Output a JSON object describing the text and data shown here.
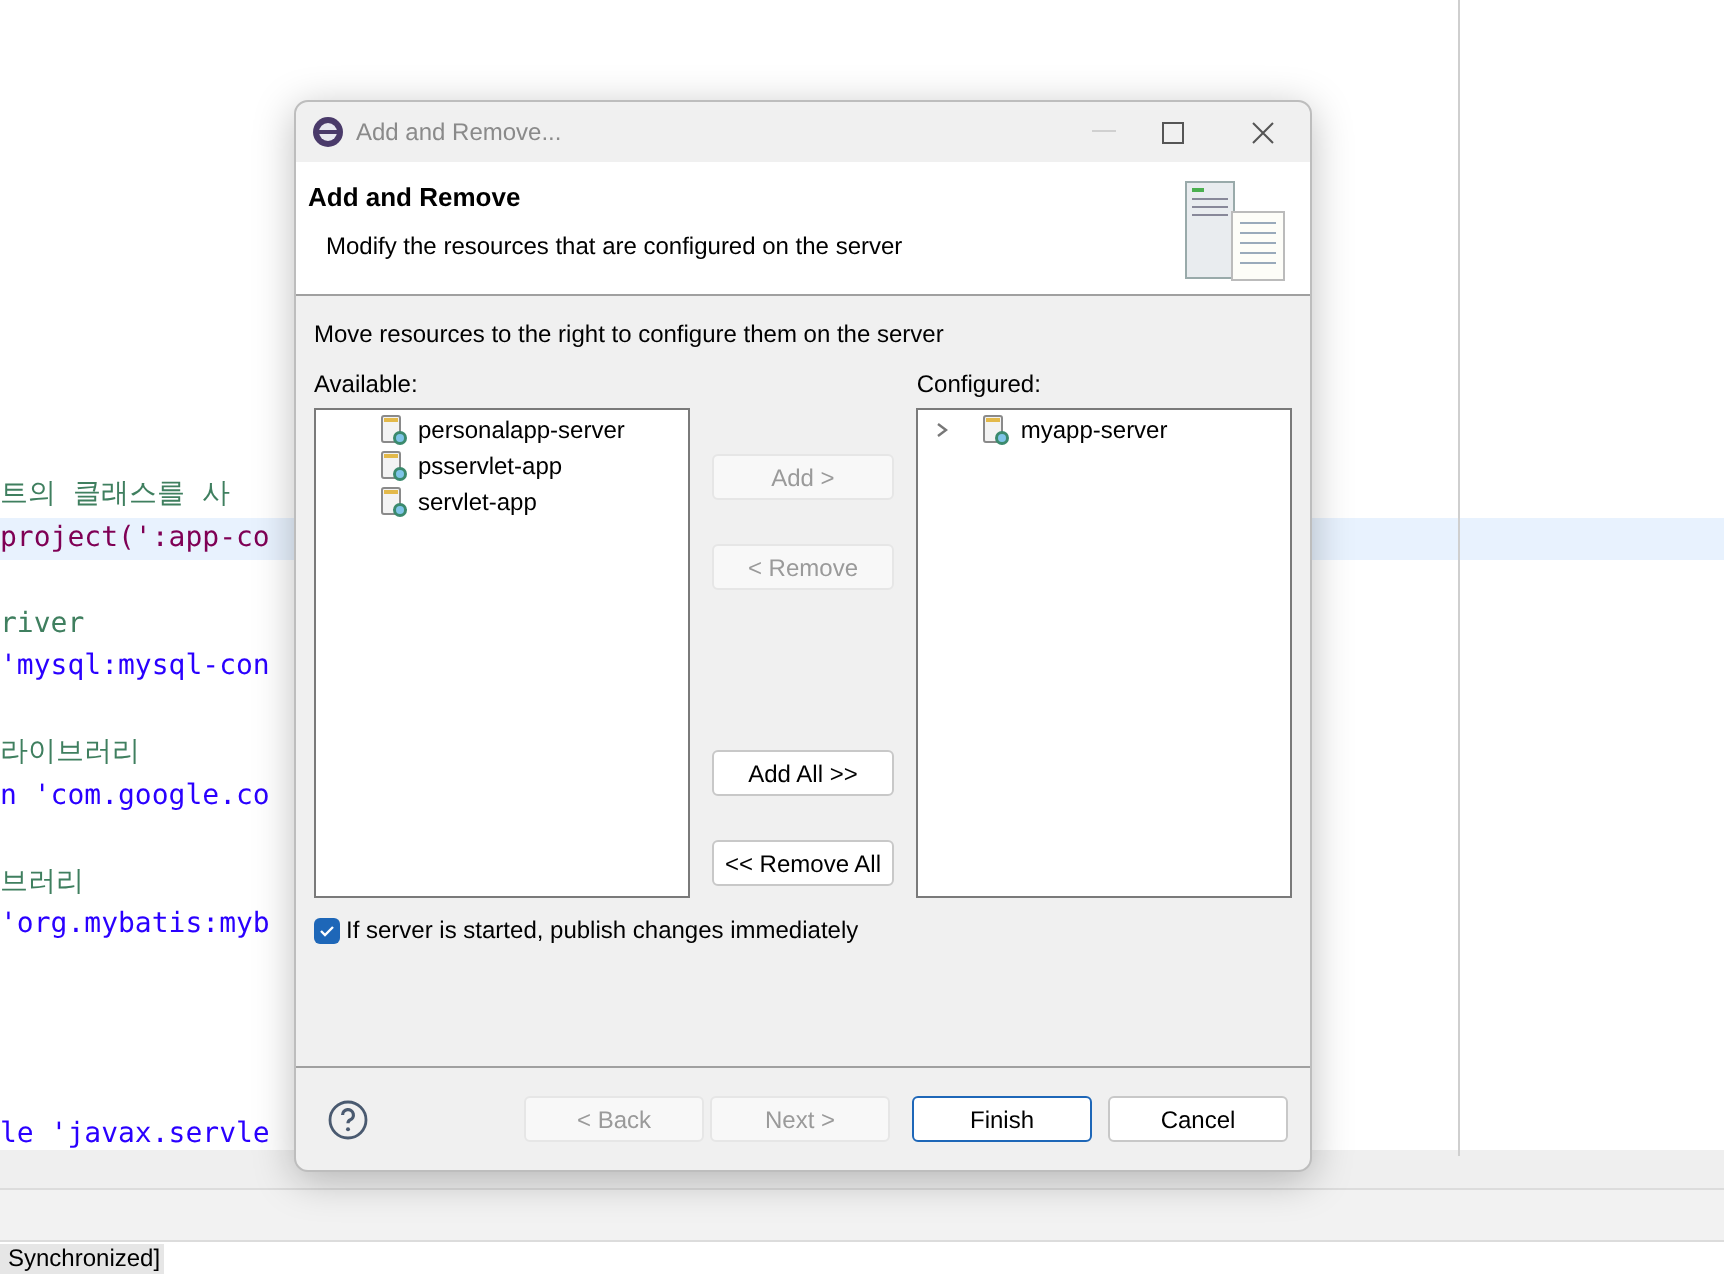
{
  "editor": {
    "lines": [
      {
        "text": "트의 클래스를 사",
        "kind": "comment",
        "selected": false
      },
      {
        "text": "project(':app-co",
        "kind": "code",
        "selected": true
      },
      {
        "kind": "blank",
        "selected": false
      },
      {
        "text": "river",
        "kind": "comment",
        "selected": false
      },
      {
        "text": "'mysql:mysql-con",
        "kind": "string",
        "selected": false
      },
      {
        "kind": "blank",
        "selected": false
      },
      {
        "text": "라이브러리",
        "kind": "comment",
        "selected": false
      },
      {
        "text": "n 'com.google.co",
        "kind": "string",
        "selected": false
      },
      {
        "kind": "blank",
        "selected": false
      },
      {
        "text": "브러리",
        "kind": "comment",
        "selected": false
      },
      {
        "text": "'org.mybatis:myb",
        "kind": "string",
        "selected": false
      }
    ],
    "last_line": "le 'javax.servle"
  },
  "status_bar": {
    "text": "Synchronized]"
  },
  "dialog": {
    "title": "Add and Remove...",
    "heading": "Add and Remove",
    "description": "Modify the resources that are configured on the server",
    "instruction": "Move resources to the right to configure them on the server",
    "available": {
      "label": "Available:",
      "items": [
        {
          "label": "personalapp-server",
          "expandable": false
        },
        {
          "label": "psservlet-app",
          "expandable": false
        },
        {
          "label": "servlet-app",
          "expandable": false
        }
      ]
    },
    "configured": {
      "label": "Configured:",
      "items": [
        {
          "label": "myapp-server",
          "expandable": true
        }
      ]
    },
    "move_buttons": [
      {
        "label": "Add >",
        "disabled": true
      },
      {
        "label": "< Remove",
        "disabled": true
      },
      {
        "label": "Add All >>",
        "disabled": false
      },
      {
        "label": "<< Remove All",
        "disabled": false
      }
    ],
    "publish": {
      "label": "If server is started, publish changes immediately",
      "checked": true
    },
    "footer_buttons": [
      {
        "label": "< Back",
        "disabled": true,
        "default": false
      },
      {
        "label": "Next >",
        "disabled": true,
        "default": false
      },
      {
        "label": "Finish",
        "disabled": false,
        "default": true
      },
      {
        "label": "Cancel",
        "disabled": false,
        "default": false
      }
    ]
  }
}
